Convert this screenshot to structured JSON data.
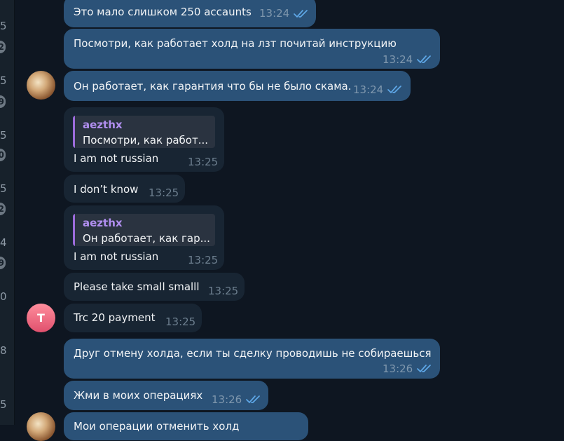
{
  "sidebar_strip": {
    "numbers": [
      "5",
      "5",
      "5",
      "5",
      "4",
      "0",
      "8",
      "5"
    ],
    "badges": [
      "2",
      "9",
      "0",
      "2",
      "9"
    ]
  },
  "messages": [
    {
      "text": "Это мало слишком 250 accaunts",
      "time": "13:24",
      "read": true
    },
    {
      "text": "Посмотри, как работает холд на лзт почитай инструкцию",
      "time": "13:24",
      "read": true
    },
    {
      "text": "Он работает, как гарантия что бы не было скама.",
      "time": "13:24",
      "read": true
    },
    {
      "reply_name": "aezthx",
      "reply_text": "Посмотри, как работ...",
      "text": "I am not russian",
      "time": "13:25"
    },
    {
      "text": "I don’t know",
      "time": "13:25"
    },
    {
      "reply_name": "aezthx",
      "reply_text": "Он работает, как гар...",
      "text": "I am not russian",
      "time": "13:25"
    },
    {
      "text": "Please take small smalll",
      "time": "13:25"
    },
    {
      "text": "Trc 20 payment",
      "time": "13:25"
    },
    {
      "text": "Друг отмену холда, если ты сделку проводишь не собираешься",
      "time": "13:26",
      "read": true
    },
    {
      "text": "Жми в моих операциях",
      "time": "13:26",
      "read": true
    },
    {
      "text": "Мои операции отменить холд"
    }
  ],
  "avatars": {
    "contact_letter": "T"
  },
  "colors": {
    "background": "#0e1621",
    "outgoing_bubble": "#2b5278",
    "incoming_bubble": "#182533",
    "reply_accent": "#9c6cdb",
    "check_color": "#5fa8e8"
  },
  "icons": {
    "read_receipt": "double-check-icon"
  }
}
